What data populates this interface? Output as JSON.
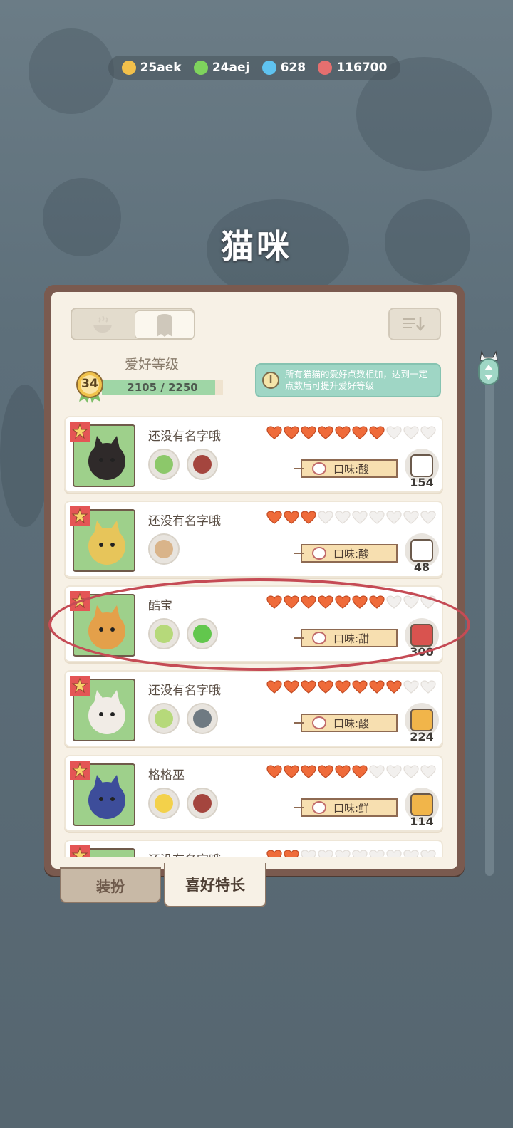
{
  "currencies": [
    {
      "icon": "coin-icon",
      "value": "25aek",
      "color": "#f2c04b"
    },
    {
      "icon": "energy-icon",
      "value": "24aej",
      "color": "#7fd35d"
    },
    {
      "icon": "gem-icon",
      "value": "628",
      "color": "#5fc3f0"
    },
    {
      "icon": "yarn-icon",
      "value": "116700",
      "color": "#e56f6f"
    }
  ],
  "page_title": "猫咪",
  "hobby": {
    "title": "爱好等级",
    "level": "34",
    "progress_text": "2105 / 2250",
    "progress_fraction": 0.935,
    "info_text": "所有猫猫的爱好点数相加，达到一定点数后可提升爱好等级"
  },
  "cats": [
    {
      "name": "还没有名字哦",
      "hearts_filled": 7,
      "hearts_total": 10,
      "taste": "口味:酸",
      "gift_count": "154",
      "skills": [
        "cabbage-icon",
        "jar-icon"
      ],
      "gift_icon": "cards-icon",
      "avatar_color": "#2f2a2a",
      "bg": "#9ed08b"
    },
    {
      "name": "还没有名字哦",
      "hearts_filled": 3,
      "hearts_total": 10,
      "taste": "口味:酸",
      "gift_count": "48",
      "skills": [
        "lotus-root-icon"
      ],
      "gift_icon": "cards-icon",
      "avatar_color": "#e7c55a",
      "bg": "#9ed08b"
    },
    {
      "name": "酷宝",
      "hearts_filled": 7,
      "hearts_total": 10,
      "taste": "口味:甜",
      "gift_count": "300",
      "skills": [
        "celery-icon",
        "energy-icon"
      ],
      "gift_icon": "washing-machine-icon",
      "avatar_color": "#e4a04a",
      "bg": "#9ed08b"
    },
    {
      "name": "还没有名字哦",
      "hearts_filled": 8,
      "hearts_total": 10,
      "taste": "口味:酸",
      "gift_count": "224",
      "skills": [
        "celery-icon",
        "camera-icon"
      ],
      "gift_icon": "pudding-icon",
      "avatar_color": "#f1ece6",
      "bg": "#9ed08b"
    },
    {
      "name": "格格巫",
      "hearts_filled": 6,
      "hearts_total": 10,
      "taste": "口味:鲜",
      "gift_count": "114",
      "skills": [
        "lemon-icon",
        "jar-icon"
      ],
      "gift_icon": "pudding-icon",
      "avatar_color": "#3d4d9a",
      "bg": "#9ed08b"
    },
    {
      "name": "还没有名字哦",
      "hearts_filled": 2,
      "hearts_total": 10,
      "taste": "",
      "gift_count": "",
      "skills": [],
      "gift_icon": "",
      "avatar_color": "#9ed08b",
      "bg": "#9ed08b"
    }
  ],
  "tabs": {
    "dress_up": "装扮",
    "hobbies": "喜好特长"
  },
  "colors": {
    "heart_filled": "#ef6b3a",
    "heart_empty": "#f2f0ee",
    "highlight_circle": "#c54b55"
  }
}
